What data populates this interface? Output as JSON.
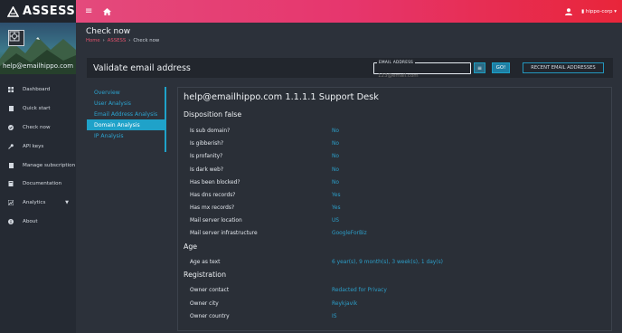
{
  "brand": {
    "name": "ASSESS"
  },
  "user": {
    "email": "help@emailhippo.com"
  },
  "sidebar": {
    "items": [
      {
        "label": "Dashboard",
        "icon": "grid-icon"
      },
      {
        "label": "Quick start",
        "icon": "file-icon"
      },
      {
        "label": "Check now",
        "icon": "check-circle-icon"
      },
      {
        "label": "API keys",
        "icon": "key-icon"
      },
      {
        "label": "Manage subscription",
        "icon": "file-icon"
      },
      {
        "label": "Documentation",
        "icon": "book-icon"
      },
      {
        "label": "Analytics",
        "icon": "chart-icon"
      },
      {
        "label": "About",
        "icon": "info-icon"
      }
    ]
  },
  "topbar": {
    "company": "hippo-corp"
  },
  "page": {
    "title": "Check now",
    "breadcrumb": [
      "Home",
      "ASSESS",
      "Check now"
    ]
  },
  "validate": {
    "title": "Validate email address",
    "email_legend": "EMAIL ADDRESS",
    "email_placeholder": "123@email.com",
    "go_label": "GO!",
    "recent_label": "RECENT EMAIL ADDRESSES"
  },
  "subnav": {
    "items": [
      "Overview",
      "User Analysis",
      "Email Address Analysis",
      "Domain Analysis",
      "IP Analysis"
    ],
    "active": "Domain Analysis"
  },
  "result": {
    "title": "help@emailhippo.com 1.1.1.1 Support Desk",
    "sections": [
      {
        "heading": "Disposition false",
        "rows": [
          {
            "label": "Is sub domain?",
            "value": "No"
          },
          {
            "label": "Is gibberish?",
            "value": "No"
          },
          {
            "label": "Is profanity?",
            "value": "No"
          },
          {
            "label": "Is dark web?",
            "value": "No"
          },
          {
            "label": "Has been blocked?",
            "value": "No"
          },
          {
            "label": "Has dns records?",
            "value": "Yes"
          },
          {
            "label": "Has mx records?",
            "value": "Yes"
          },
          {
            "label": "Mail server location",
            "value": "US"
          },
          {
            "label": "Mail server infrastructure",
            "value": "GoogleForBiz"
          }
        ]
      },
      {
        "heading": "Age",
        "rows": [
          {
            "label": "Age as text",
            "value": "6 year(s), 9 month(s), 3 week(s), 1 day(s)"
          }
        ]
      },
      {
        "heading": "Registration",
        "rows": [
          {
            "label": "Owner contact",
            "value": "Redacted for Privacy"
          },
          {
            "label": "Owner city",
            "value": "Reykjavik"
          },
          {
            "label": "Owner country",
            "value": "IS"
          }
        ]
      }
    ]
  }
}
